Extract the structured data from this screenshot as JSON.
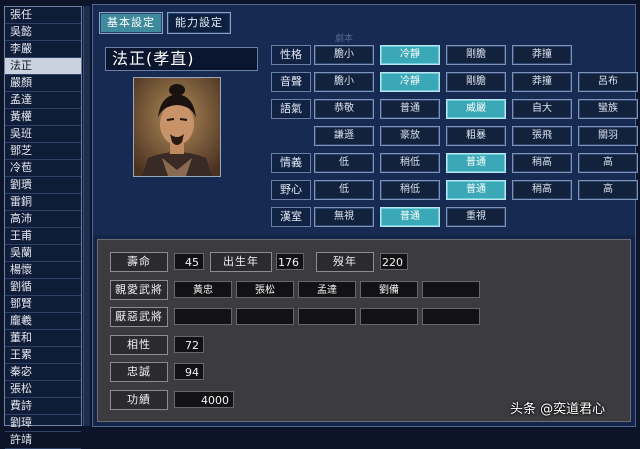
{
  "officer_list": [
    "張任",
    "吳懿",
    "李嚴",
    "法正",
    "嚴顏",
    "孟達",
    "黃權",
    "吳班",
    "鄧芝",
    "冷苞",
    "劉璝",
    "雷銅",
    "高沛",
    "王甫",
    "吳蘭",
    "楊懷",
    "劉循",
    "鄧賢",
    "龐羲",
    "董和",
    "王累",
    "秦宓",
    "張松",
    "費詩",
    "劉璋",
    "許靖"
  ],
  "selected_index": 3,
  "tabs": {
    "basic": "基本設定",
    "ability": "能力設定"
  },
  "title_tag": "劇本",
  "name": "法正(孝直)",
  "attributes": [
    {
      "label": "性格",
      "options": [
        "膽小",
        "冷靜",
        "剛膽",
        "莽撞"
      ],
      "selected": [
        1
      ]
    },
    {
      "label": "音聲",
      "options": [
        "膽小",
        "冷靜",
        "剛膽",
        "莽撞",
        "呂布"
      ],
      "selected": [
        1
      ]
    },
    {
      "label": "語氣",
      "options": [
        "恭敬",
        "普通",
        "威嚴",
        "自大",
        "蠻族"
      ],
      "selected": [
        2
      ]
    },
    {
      "label": "",
      "options": [
        "謙遜",
        "豪放",
        "粗暴",
        "張飛",
        "關羽"
      ],
      "selected": []
    },
    {
      "label": "情義",
      "options": [
        "低",
        "稍低",
        "普通",
        "稍高",
        "高"
      ],
      "selected": [
        2
      ]
    },
    {
      "label": "野心",
      "options": [
        "低",
        "稍低",
        "普通",
        "稍高",
        "高"
      ],
      "selected": [
        2
      ]
    },
    {
      "label": "漢室",
      "options": [
        "無視",
        "普通",
        "重視"
      ],
      "selected": [
        1
      ]
    }
  ],
  "stats": {
    "lifespan_label": "壽命",
    "lifespan": "45",
    "birth_label": "出生年",
    "birth": "176",
    "death_label": "歿年",
    "death": "220",
    "favorite_label": "親愛武將",
    "favorites": [
      "黃忠",
      "張松",
      "孟達",
      "劉備",
      ""
    ],
    "disliked_label": "厭惡武將",
    "disliked": [
      "",
      "",
      "",
      "",
      ""
    ],
    "compat_label": "相性",
    "compat": "72",
    "loyalty_label": "忠誠",
    "loyalty": "94",
    "merit_label": "功績",
    "merit": "4000"
  },
  "watermark": "头条 @奕道君心",
  "colors": {
    "selected_option": "#3aa8b6",
    "panel_blue": "#14254a",
    "panel_grey": "#3c3c40"
  }
}
